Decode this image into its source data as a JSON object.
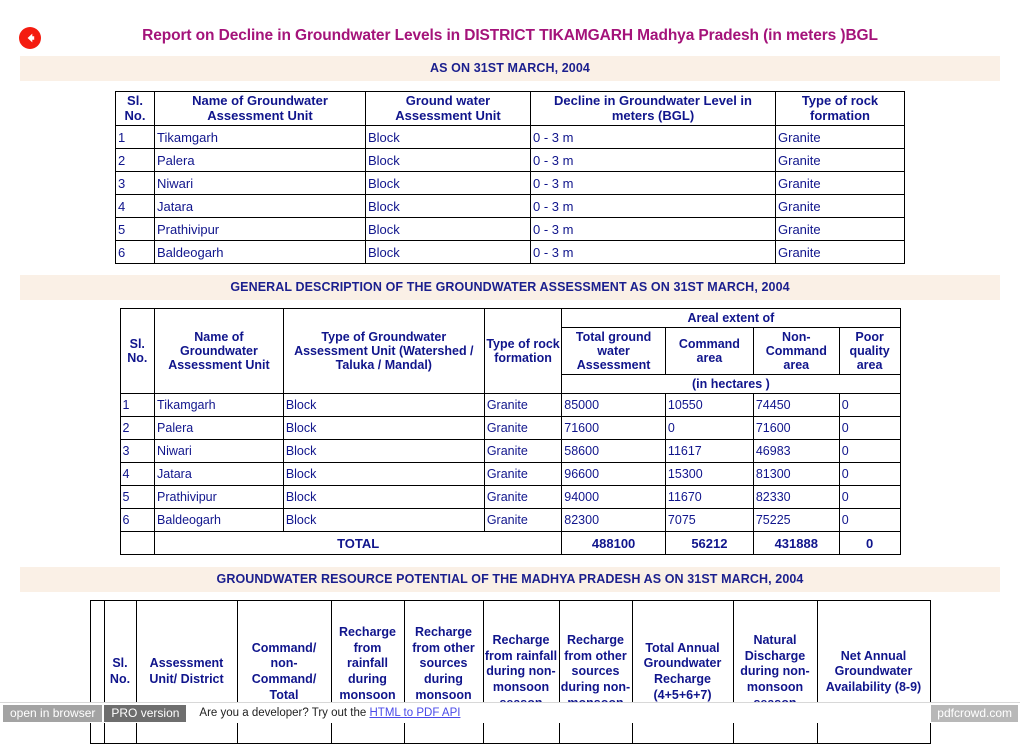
{
  "header": {
    "back_icon": "back-arrow-icon",
    "title": "Report on Decline in Groundwater Levels in DISTRICT TIKAMGARH Madhya Pradesh (in meters )BGL",
    "title_color": "#a4137a"
  },
  "bands": {
    "band1": "AS ON 31ST MARCH, 2004",
    "band2": "GENERAL DESCRIPTION OF THE GROUNDWATER ASSESSMENT AS ON 31ST MARCH, 2004",
    "band3": "GROUNDWATER RESOURCE POTENTIAL OF THE MADHYA PRADESH AS ON 31ST MARCH, 2004",
    "band_bg": "#faf0e6",
    "band_color": "#1b1f8e"
  },
  "table1": {
    "headers": [
      "Sl. No.",
      "Name of Groundwater Assessment Unit",
      "Ground water Assessment Unit",
      "Decline in Groundwater Level in meters (BGL)",
      "Type of rock formation"
    ],
    "rows": [
      [
        "1",
        "Tikamgarh",
        "Block",
        "0 - 3 m",
        "Granite"
      ],
      [
        "2",
        "Palera",
        "Block",
        "0 - 3 m",
        "Granite"
      ],
      [
        "3",
        "Niwari",
        "Block",
        "0 - 3 m",
        "Granite"
      ],
      [
        "4",
        "Jatara",
        "Block",
        "0 - 3 m",
        "Granite"
      ],
      [
        "5",
        "Prathivipur",
        "Block",
        "0 - 3 m",
        "Granite"
      ],
      [
        "6",
        "Baldeogarh",
        "Block",
        "0 - 3 m",
        "Granite"
      ]
    ]
  },
  "table2": {
    "headers": {
      "sl_no": "Sl. No.",
      "name": "Name of Groundwater Assessment Unit",
      "type_unit": "Type of Groundwater Assessment Unit (Watershed / Taluka / Mandal)",
      "rock": "Type of rock formation",
      "areal_extent": "Areal extent of",
      "total_gw": "Total ground water Assessment",
      "command": "Command area",
      "non_command": "Non-Command area",
      "poor_quality": "Poor quality area",
      "hectares": "(in hectares )"
    },
    "rows": [
      [
        "1",
        "Tikamgarh",
        "Block",
        "Granite",
        "85000",
        "10550",
        "74450",
        "0"
      ],
      [
        "2",
        "Palera",
        "Block",
        "Granite",
        "71600",
        "0",
        "71600",
        "0"
      ],
      [
        "3",
        "Niwari",
        "Block",
        "Granite",
        "58600",
        "11617",
        "46983",
        "0"
      ],
      [
        "4",
        "Jatara",
        "Block",
        "Granite",
        "96600",
        "15300",
        "81300",
        "0"
      ],
      [
        "5",
        "Prathivipur",
        "Block",
        "Granite",
        "94000",
        "11670",
        "82330",
        "0"
      ],
      [
        "6",
        "Baldeogarh",
        "Block",
        "Granite",
        "82300",
        "7075",
        "75225",
        "0"
      ]
    ],
    "total": {
      "label": "TOTAL",
      "values": [
        "488100",
        "56212",
        "431888",
        "0"
      ]
    }
  },
  "table3": {
    "headers": [
      "",
      "Sl. No.",
      "Assessment Unit/ District",
      "Command/ non-Command/ Total",
      "Recharge from rainfall during monsoon season",
      "Recharge from other sources during monsoon season",
      "Recharge from rainfall during non-monsoon season",
      "Recharge from other sources during non-monsoon",
      "Total Annual Groundwater Recharge (4+5+6+7)",
      "Natural Discharge during non-monsoon season",
      "Net Annual Groundwater Availability (8-9)"
    ]
  },
  "footer": {
    "open_in_browser": "open in browser",
    "pro_version": "PRO version",
    "dev_text": "Are you a developer? Try out the",
    "link_text": "HTML to PDF API",
    "brand": "pdfcrowd.com"
  }
}
